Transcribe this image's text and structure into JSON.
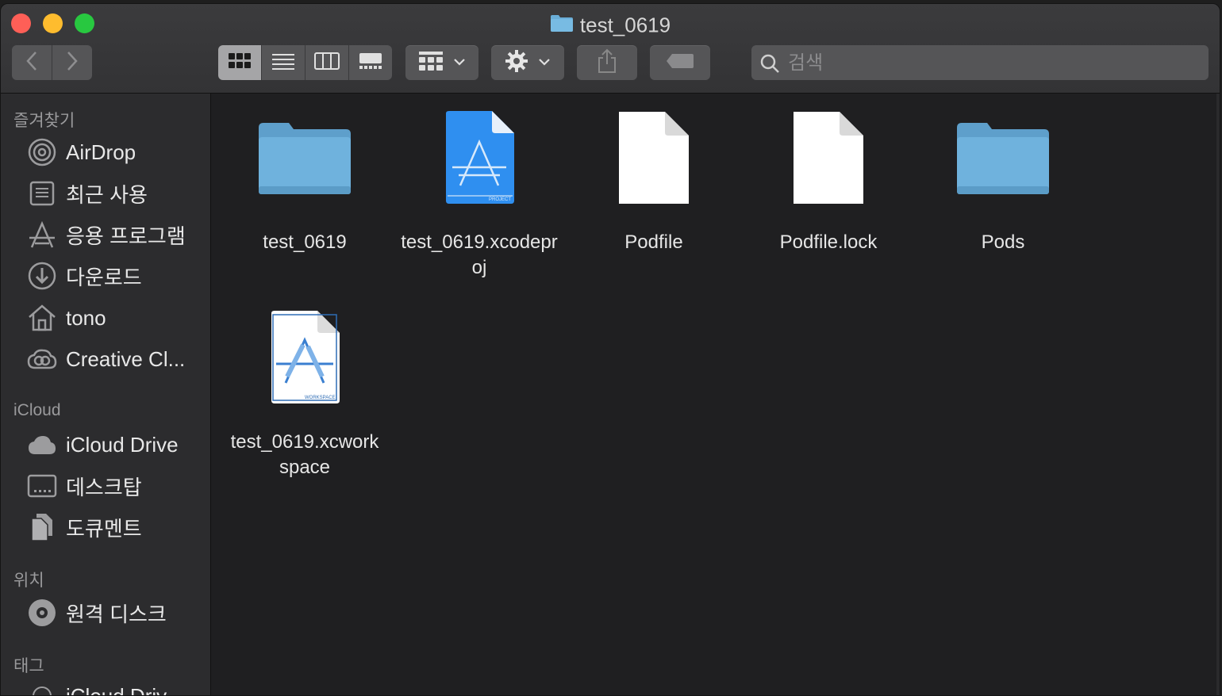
{
  "window": {
    "title": "test_0619"
  },
  "toolbar": {
    "back_icon": "chevron-left-icon",
    "forward_icon": "chevron-right-icon",
    "view_modes": [
      "icon-view-icon",
      "list-view-icon",
      "column-view-icon",
      "gallery-view-icon"
    ],
    "active_view": 0,
    "group_icon": "group-by-icon",
    "action_icon": "gear-icon",
    "share_icon": "share-icon",
    "tag_icon": "tag-icon",
    "search_placeholder": "검색"
  },
  "sidebar": {
    "favorites_title": "즐겨찾기",
    "favorites": [
      {
        "label": "AirDrop",
        "icon": "airdrop-icon"
      },
      {
        "label": "최근 사용",
        "icon": "recents-icon"
      },
      {
        "label": "응용 프로그램",
        "icon": "applications-icon"
      },
      {
        "label": "다운로드",
        "icon": "downloads-icon"
      },
      {
        "label": "tono",
        "icon": "home-icon"
      },
      {
        "label": "Creative Cl...",
        "icon": "creative-cloud-icon"
      }
    ],
    "icloud_title": "iCloud",
    "icloud": [
      {
        "label": "iCloud Drive",
        "icon": "cloud-icon"
      },
      {
        "label": "데스크탑",
        "icon": "desktop-icon"
      },
      {
        "label": "도큐멘트",
        "icon": "documents-icon"
      }
    ],
    "locations_title": "위치",
    "locations": [
      {
        "label": "원격 디스크",
        "icon": "remote-disc-icon"
      }
    ],
    "tags_title": "태그",
    "tags": [
      {
        "label": "iCloud Driv",
        "icon": "tag-circle-icon"
      }
    ]
  },
  "files": [
    {
      "name": "test_0619",
      "kind": "folder"
    },
    {
      "name": "test_0619.xcodeproj",
      "kind": "xcodeproj"
    },
    {
      "name": "Podfile",
      "kind": "document"
    },
    {
      "name": "Podfile.lock",
      "kind": "document"
    },
    {
      "name": "Pods",
      "kind": "folder"
    },
    {
      "name": "test_0619.xcworkspace",
      "kind": "xcworkspace"
    }
  ],
  "colors": {
    "folder": "#6aaed8",
    "xcode_blue": "#2f8ff0",
    "close": "#fe5f57",
    "minimize": "#febc2e",
    "maximize": "#28c840"
  }
}
